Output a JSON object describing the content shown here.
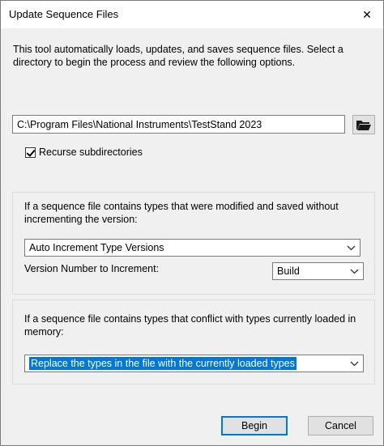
{
  "window": {
    "title": "Update Sequence Files"
  },
  "description": "This tool automatically loads, updates, and saves sequence files. Select a directory to begin the process and review the following options.",
  "directory": {
    "value": "C:\\Program Files\\National Instruments\\TestStand 2023"
  },
  "recurse": {
    "label": "Recurse subdirectories",
    "checked": true
  },
  "group_modified": {
    "text": "If a sequence file contains types that were modified and saved without incrementing the version:",
    "action_select": "Auto Increment Type Versions",
    "version_label": "Version Number to Increment:",
    "version_select": "Build"
  },
  "group_conflict": {
    "text": "If a sequence file contains types that conflict with types currently loaded in memory:",
    "action_select": "Replace the types in the file with the currently loaded types"
  },
  "buttons": {
    "begin": "Begin",
    "cancel": "Cancel"
  },
  "icons": {
    "close": "close-icon",
    "folder": "folder-open-icon",
    "dropdown": "chevron-down-icon"
  }
}
